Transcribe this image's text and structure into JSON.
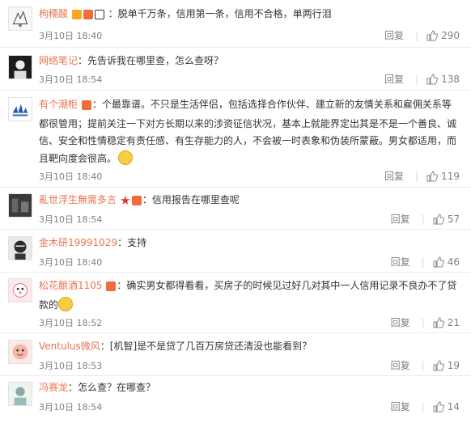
{
  "comments": [
    {
      "user": "枸糥酸",
      "text": "：脱单千万条，信用第一条，信用不合格，单两行泪",
      "time": "3月10日 18:40",
      "reply": "回复",
      "likes": "290"
    },
    {
      "user": "网络笔记",
      "text": "：先告诉我在哪里查，怎么查呀？",
      "time": "3月10日 18:54",
      "reply": "回复",
      "likes": "138"
    },
    {
      "user": "有个潮柜",
      "text_1": "：个最靠谱。不只是生活伴侣，包括选择合作伙伴、建立新的友情关系和雇佣关系等",
      "text_2": "都很管用；提前关注一下对方长期以来的涉资征信状况，基本上就能界定出其是不是一个善良、诚",
      "text_3": "信、安全和性情稳定有责任感、有生存能力的人，不会被一时表象和伪装所蒙蔽。男女都适用，而",
      "text_4": "且靶向度会很高。",
      "time": "3月10日 18:40",
      "reply": "回复",
      "likes": "119"
    },
    {
      "user": "亂世浮生無需多言",
      "text": "：信用报告在哪里查呢",
      "time": "3月10日 18:54",
      "reply": "回复",
      "likes": "57"
    },
    {
      "user": "金木研19991029",
      "text": "：支持",
      "time": "3月10日 18:40",
      "reply": "回复",
      "likes": "46"
    },
    {
      "user": "松花酿酒1105",
      "text_1": "：确实男女都得看看，买房子的时候见过好几对其中一人信用记录不良办不了贷",
      "text_2": "款的",
      "time": "3月10日 18:52",
      "reply": "回复",
      "likes": "21"
    },
    {
      "user": "Ventulus微风",
      "text": "：[机智]是不是贷了几百万房贷还清没也能看到？",
      "time": "3月10日 18:53",
      "reply": "回复",
      "likes": "19"
    },
    {
      "user": "冯赛龙",
      "text": "：怎么查？在哪查？",
      "time": "3月10日 18:54",
      "reply": "回复",
      "likes": "14"
    }
  ],
  "colors": {
    "username": "#eb7350",
    "meta": "#808080",
    "text": "#333333",
    "divider": "#ececec"
  }
}
